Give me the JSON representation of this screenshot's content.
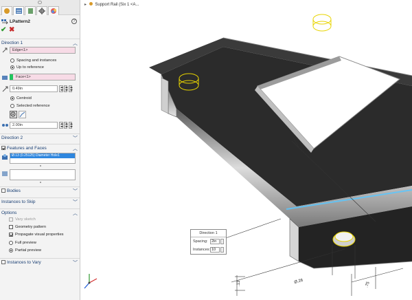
{
  "panel": {
    "title": "LPattern2",
    "help_glyph": "?",
    "ok_glyph": "✔",
    "cancel_glyph": "✖",
    "tabs": [
      "feature-manager",
      "property-manager",
      "configuration-manager",
      "dimxpert-manager",
      "display-manager"
    ],
    "direction1": {
      "label": "Direction 1",
      "edge_field": "Edge<1>",
      "spacing_option": "Spacing and instances",
      "up_to_option": "Up to reference",
      "reference_field": "Face<1>",
      "offset_value": "0.49in",
      "centroid_option": "Centroid",
      "selected_ref_option": "Selected reference",
      "spacing_value": "2.00in"
    },
    "direction2": {
      "label": "Direction 2"
    },
    "features_faces": {
      "label": "Features and Faces",
      "selected_item": "Ø.13 (0.25125) Diameter Hole1"
    },
    "bodies": {
      "label": "Bodies"
    },
    "instances_to_skip": {
      "label": "Instances to Skip"
    },
    "options": {
      "label": "Options",
      "vary_sketch": "Vary sketch",
      "geometry_pattern": "Geometry pattern",
      "propagate": "Propagate visual properties",
      "full_preview": "Full preview",
      "partial_preview": "Partial preview"
    },
    "instances_to_vary": {
      "label": "Instances to Vary"
    }
  },
  "graphics": {
    "breadcrumb": "Support Rail (Six 1 <A...",
    "callout": {
      "title": "Direction 1",
      "spacing_label": "Spacing:",
      "spacing_value": "2in",
      "instances_label": "Instances:",
      "instances_value": "10"
    },
    "dim_labels": {
      "diameter": "Ø.26",
      "height": ".13",
      "width": ".75"
    }
  },
  "colors": {
    "accent": "#1a3f73",
    "selection_blue": "#2e86de",
    "preview_yellow": "#e8d400",
    "pink_field": "#f7dbe6",
    "green_flag": "#22c55e"
  }
}
